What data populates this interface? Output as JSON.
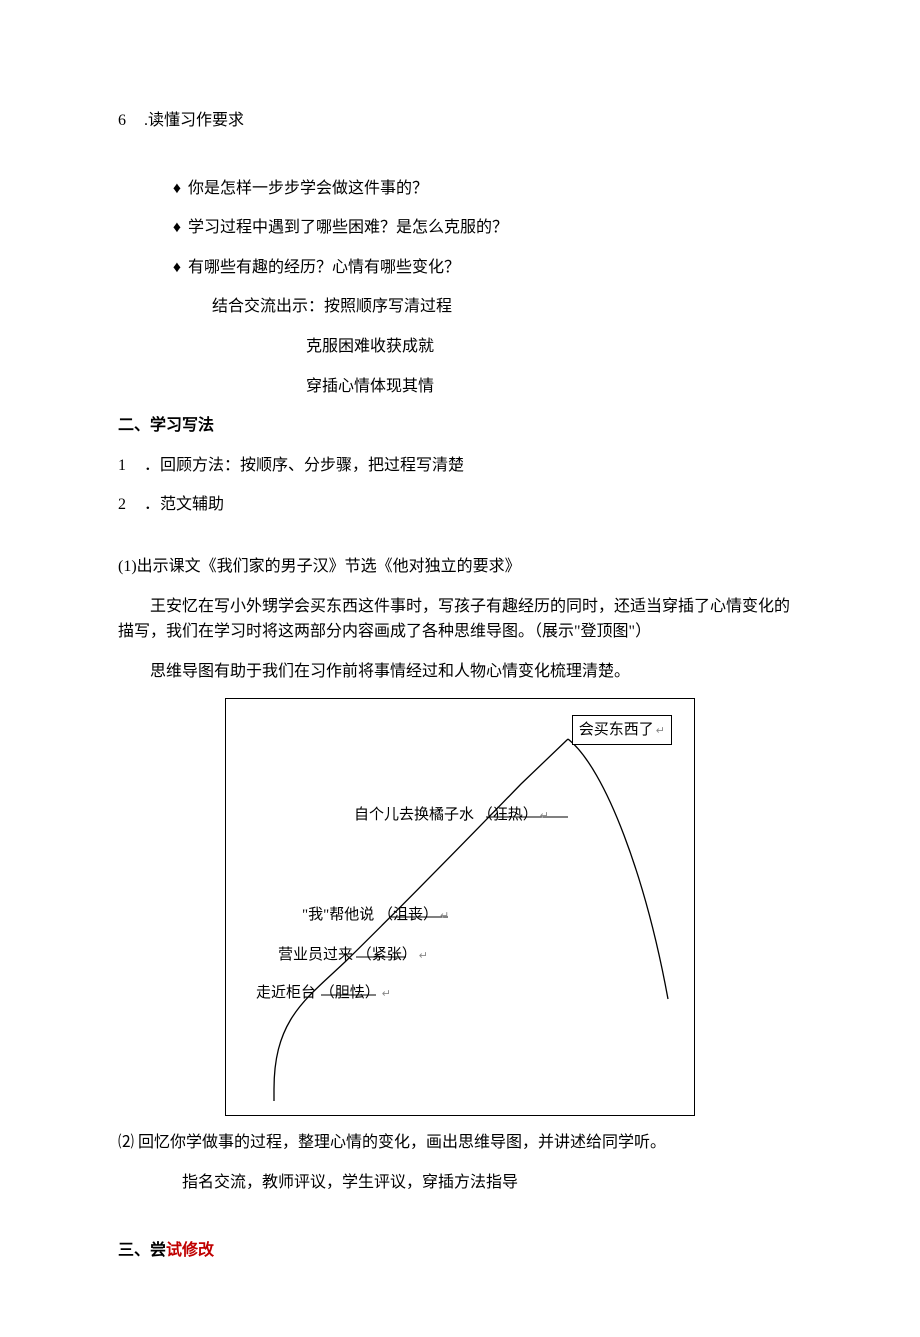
{
  "i6": {
    "num": "6",
    "text": ".读懂习作要求"
  },
  "bullet_sym": "♦",
  "b1": "你是怎样一步步学会做这件事的？",
  "b2": "学习过程中遇到了哪些困难？是怎么克服的？",
  "b3": "有哪些有趣的经历？心情有哪些变化？",
  "exchange_line": "结合交流出示：按照顺序写清过程",
  "sub1": "克服困难收获成就",
  "sub2": "穿插心情体现其情",
  "s2_title": "二、学习写法",
  "m1": {
    "num": "1",
    "text": "．回顾方法：按顺序、分步骤，把过程写清楚"
  },
  "m2": {
    "num": "2",
    "text": "．范文辅助"
  },
  "p1_label": "(1)",
  "p1_text": "出示课文《我们家的男子汉》节选《他对独立的要求》",
  "para1": "王安忆在写小外甥学会买东西这件事时，写孩子有趣经历的同时，还适当穿插了心情变化的描写，我们在学习时将这两部分内容画成了各种思维导图。（展示\"登顶图\"）",
  "para2": "思维导图有助于我们在习作前将事情经过和人物心情变化梳理清楚。",
  "chart_data": {
    "type": "line",
    "top_box": "会买东西了",
    "labels": [
      {
        "text": "自个儿去换橘子水",
        "mood": "（狂热）"
      },
      {
        "text": "\"我\"帮他说",
        "mood": "（沮丧）"
      },
      {
        "text": "营业员过来",
        "mood": "（紧张）"
      },
      {
        "text": "走近柜台",
        "mood": "（胆怯）"
      }
    ]
  },
  "p2_label": "⑵",
  "p2_text": "回忆你学做事的过程，整理心情的变化，画出思维导图，并讲述给同学听。",
  "p2_sub": "指名交流，教师评议，学生评议，穿插方法指导",
  "s3_pre": "三、尝",
  "s3_red": "试修改"
}
